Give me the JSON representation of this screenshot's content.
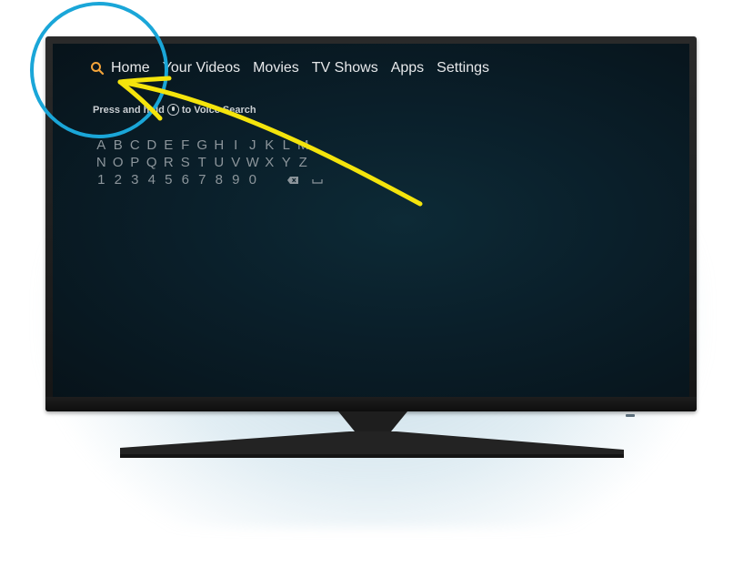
{
  "menu": {
    "items": [
      "Home",
      "Your Videos",
      "Movies",
      "TV Shows",
      "Apps",
      "Settings"
    ]
  },
  "voice_hint": {
    "before": "Press and hold",
    "after": "to Voice Search"
  },
  "keyboard": {
    "rows": [
      [
        "A",
        "B",
        "C",
        "D",
        "E",
        "F",
        "G",
        "H",
        "I",
        "J",
        "K",
        "L",
        "M"
      ],
      [
        "N",
        "O",
        "P",
        "Q",
        "R",
        "S",
        "T",
        "U",
        "V",
        "W",
        "X",
        "Y",
        "Z"
      ],
      [
        "1",
        "2",
        "3",
        "4",
        "5",
        "6",
        "7",
        "8",
        "9",
        "0"
      ]
    ],
    "backspace_icon": "backspace-icon",
    "space_icon": "space-icon"
  },
  "icons": {
    "search": "search-icon",
    "mic": "microphone-icon"
  },
  "colors": {
    "accent": "#f2a33a",
    "annotation_circle": "#1aa6d8",
    "annotation_arrow": "#f4e40c"
  }
}
